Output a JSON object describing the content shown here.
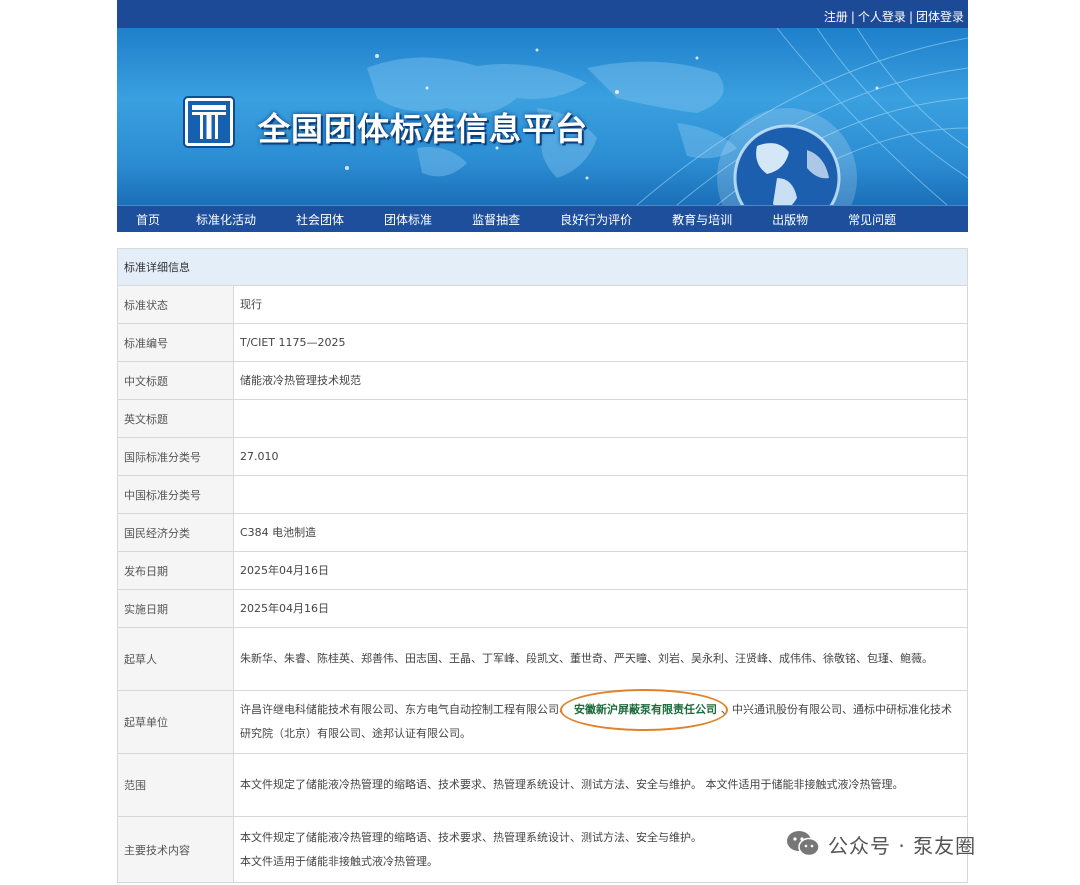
{
  "header": {
    "links": [
      "注册",
      "个人登录",
      "团体登录"
    ],
    "separator": "|",
    "site_title": "全国团体标准信息平台"
  },
  "nav": [
    "首页",
    "标准化活动",
    "社会团体",
    "团体标准",
    "监督抽查",
    "良好行为评价",
    "教育与培训",
    "出版物",
    "常见问题"
  ],
  "table": {
    "section_title": "标准详细信息",
    "rows": [
      {
        "label": "标准状态",
        "value": "现行"
      },
      {
        "label": "标准编号",
        "value": "T/CIET 1175—2025"
      },
      {
        "label": "中文标题",
        "value": "储能液冷热管理技术规范"
      },
      {
        "label": "英文标题",
        "value": ""
      },
      {
        "label": "国际标准分类号",
        "value": "27.010"
      },
      {
        "label": "中国标准分类号",
        "value": ""
      },
      {
        "label": "国民经济分类",
        "value": "C384 电池制造"
      },
      {
        "label": "发布日期",
        "value": "2025年04月16日"
      },
      {
        "label": "实施日期",
        "value": "2025年04月16日"
      },
      {
        "label": "起草人",
        "value": "朱新华、朱睿、陈桂英、郑善伟、田志国、王晶、丁军峰、段凯文、董世奇、严天瞳、刘岩、吴永利、汪贤峰、成伟伟、徐敬铭、包瑾、鲍薇。"
      }
    ],
    "drafting_unit": {
      "label": "起草单位",
      "before": "许昌许继电科储能技术有限公司、东方电气自动控制工程有限公司、",
      "highlight": "安徽新沪屏蔽泵有限责任公司",
      "after": "、中兴通讯股份有限公司、通标中研标准化技术研究院（北京）有限公司、途邦认证有限公司。"
    },
    "scope": {
      "label": "范围",
      "value": "本文件规定了储能液冷热管理的缩略语、技术要求、热管理系统设计、测试方法、安全与维护。 本文件适用于储能非接触式液冷热管理。"
    },
    "main_tech": {
      "label": "主要技术内容",
      "line1": "本文件规定了储能液冷热管理的缩略语、技术要求、热管理系统设计、测试方法、安全与维护。",
      "line2": "本文件适用于储能非接触式液冷热管理。"
    }
  },
  "watermark": {
    "icon": "wechat-icon",
    "text": "公众号 · 泵友圈"
  },
  "colors": {
    "topbar": "#1d4a96",
    "nav": "#1d4f9c",
    "table_header": "#e4eef9",
    "highlight_ring": "#e0832a",
    "highlight_text": "#1d6b3a"
  }
}
